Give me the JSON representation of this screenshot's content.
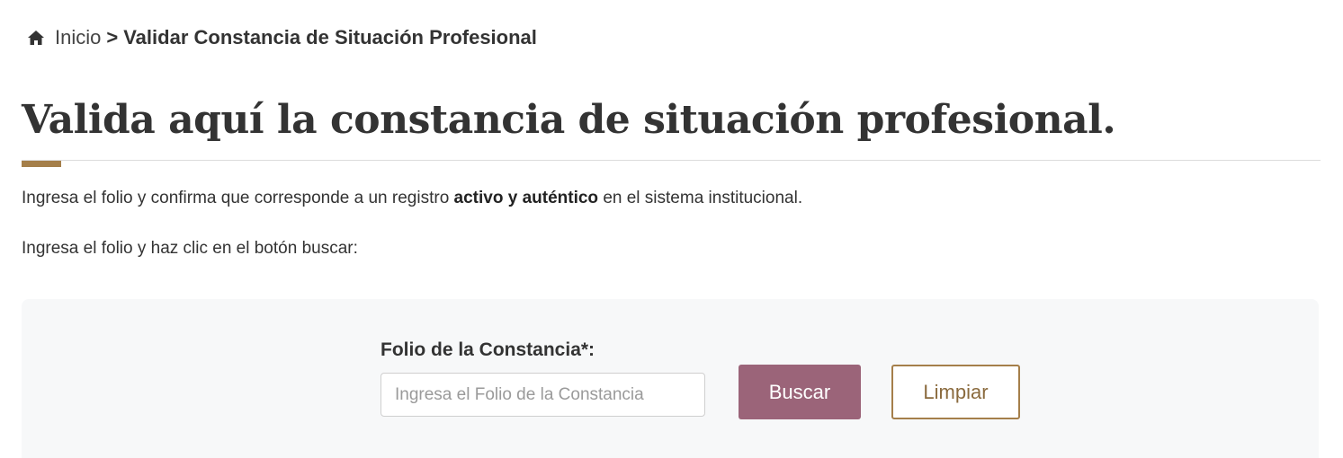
{
  "breadcrumb": {
    "home_icon": "home-icon",
    "home_label": "Inicio",
    "separator": ">",
    "current": "Validar Constancia de Situación Profesional"
  },
  "main": {
    "title": "Valida aquí la constancia de situación profesional.",
    "intro_before": "Ingresa el folio y confirma que corresponde a un registro ",
    "intro_bold": "activo y auténtico",
    "intro_after": " en el sistema institucional.",
    "instruction": "Ingresa el folio y haz clic en el botón buscar:"
  },
  "form": {
    "folio_label": "Folio de la Constancia*:",
    "folio_value": "",
    "folio_placeholder": "Ingresa el Folio de la Constancia",
    "search_label": "Buscar",
    "clear_label": "Limpiar"
  },
  "colors": {
    "accent": "#a57f4a",
    "primary_button": "#9b6479",
    "panel_background": "#f7f8f9",
    "text": "#333333"
  }
}
